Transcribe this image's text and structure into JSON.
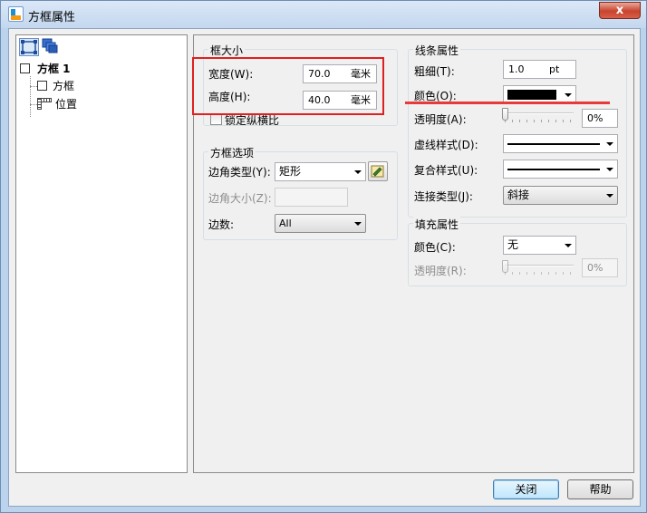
{
  "window": {
    "title": "方框属性",
    "close_symbol": "x"
  },
  "tree": {
    "root_label": "方框 1",
    "children": [
      {
        "label": "方框",
        "icon": "box-icon"
      },
      {
        "label": "位置",
        "icon": "ruler-icon"
      }
    ]
  },
  "frame_size": {
    "title": "框大小",
    "width_label": "宽度(W):",
    "width_value": "70.0",
    "width_unit": "毫米",
    "height_label": "高度(H):",
    "height_value": "40.0",
    "height_unit": "毫米",
    "lock_ratio_label": "锁定纵横比",
    "lock_ratio_checked": false
  },
  "frame_options": {
    "title": "方框选项",
    "corner_type_label": "边角类型(Y):",
    "corner_type_value": "矩形",
    "corner_size_label": "边角大小(Z):",
    "corner_size_value": "",
    "sides_label": "边数:",
    "sides_value": "All"
  },
  "line_props": {
    "title": "线条属性",
    "thickness_label": "粗细(T):",
    "thickness_value": "1.0",
    "thickness_unit": "pt",
    "color_label": "颜色(O):",
    "color_value": "#000000",
    "transparency_label": "透明度(A):",
    "transparency_value": "0%",
    "dash_label": "虚线样式(D):",
    "compound_label": "复合样式(U):",
    "join_label": "连接类型(J):",
    "join_value": "斜接"
  },
  "fill_props": {
    "title": "填充属性",
    "color_label": "颜色(C):",
    "color_value": "无",
    "transparency_label": "透明度(R):",
    "transparency_value": "0%"
  },
  "buttons": {
    "close": "关闭",
    "help": "帮助"
  },
  "colors": {
    "highlight": "#e02020",
    "title_bg": "#c3d7ef"
  }
}
